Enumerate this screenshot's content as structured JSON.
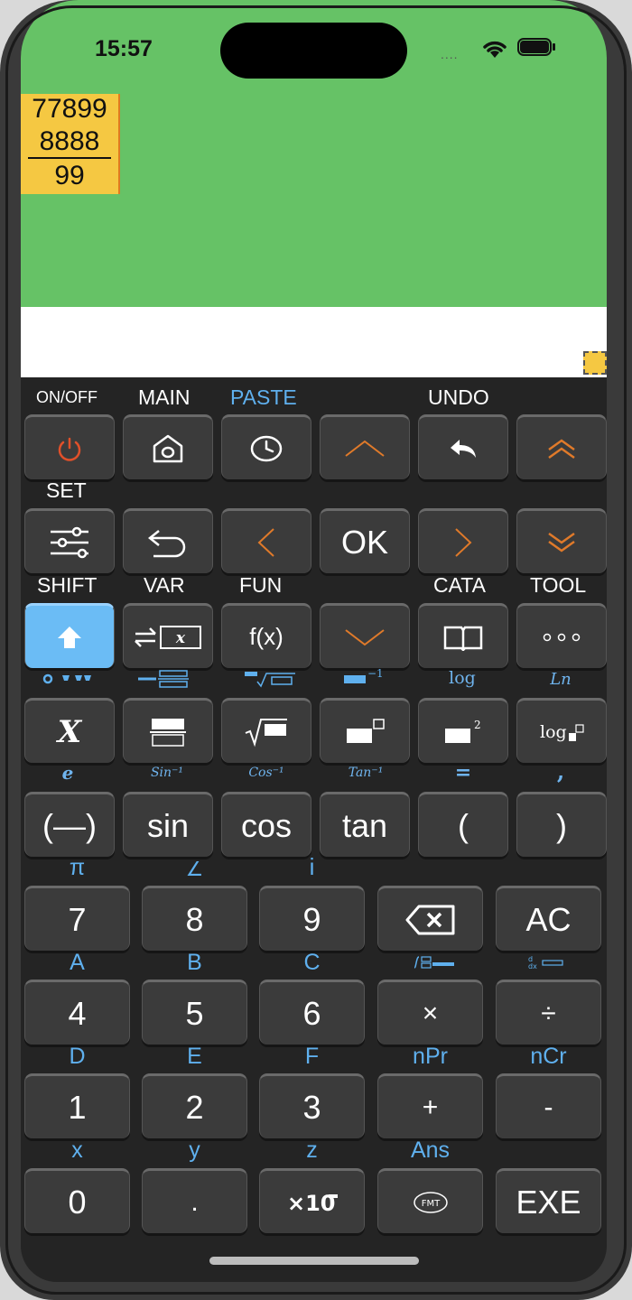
{
  "status_bar": {
    "time": "15:57",
    "dots": "....",
    "icons": [
      "wifi-icon",
      "battery-icon"
    ]
  },
  "display": {
    "fraction": {
      "integer": "77899",
      "numerator": "8888",
      "denominator": "99"
    },
    "background_color": "#66c266",
    "highlight_color": "#f5c842"
  },
  "top_labels": {
    "on_off": "ON/OFF",
    "main": "MAIN",
    "paste": "PASTE",
    "undo": "UNDO",
    "set": "SET",
    "shift": "SHIFT",
    "var": "VAR",
    "fun": "FUN",
    "cata": "CATA",
    "tool": "TOOL"
  },
  "row1_keys": [
    "power-icon",
    "home-icon",
    "history-icon",
    "chevron-up-icon",
    "undo-arrow-icon",
    "double-chevron-up-icon"
  ],
  "row2_keys": {
    "ok": "OK",
    "left": "<",
    "right": ">",
    "icons": [
      "settings-sliders-icon",
      "return-icon",
      "chevron-left-icon",
      "ok",
      "chevron-right-icon",
      "double-chevron-down-icon"
    ]
  },
  "row3_keys": {
    "fx": "f(x)",
    "var_x": "x"
  },
  "row4_shift": {
    "s1": "log",
    "s2": "Ln"
  },
  "row4_keys": {
    "x": "X",
    "log": "log"
  },
  "row5_shift": {
    "e": "e",
    "sin": "Sin⁻¹",
    "cos": "Cos⁻¹",
    "tan": "Tan⁻¹",
    "eq": "=",
    "comma": ","
  },
  "row5_keys": [
    "(—)",
    "sin",
    "cos",
    "tan",
    "(",
    ")"
  ],
  "row6_shift": {
    "pi": "π",
    "angle": "∠",
    "i": "i"
  },
  "row6_keys": {
    "k7": "7",
    "k8": "8",
    "k9": "9",
    "ac": "AC"
  },
  "row7_shift": {
    "a": "A",
    "b": "B",
    "c": "C"
  },
  "row7_keys": {
    "k4": "4",
    "k5": "5",
    "k6": "6",
    "times": "×",
    "divide": "÷"
  },
  "row8_shift": {
    "d": "D",
    "e": "E",
    "f": "F",
    "npr": "nPr",
    "ncr": "nCr"
  },
  "row8_keys": {
    "k1": "1",
    "k2": "2",
    "k3": "3",
    "plus": "+",
    "minus": "-"
  },
  "row9_shift": {
    "x": "x",
    "y": "y",
    "z": "z",
    "ans": "Ans"
  },
  "row9_keys": {
    "k0": "0",
    "dot": ".",
    "exp": "×10",
    "fmt": "FMT",
    "exe": "EXE"
  },
  "colors": {
    "key_bg": "#3b3b3b",
    "shift_blue": "#5fb0ee",
    "arrow_orange": "#e07a2a",
    "power_red": "#e0502a",
    "shift_key_blue": "#6bbcf5"
  }
}
